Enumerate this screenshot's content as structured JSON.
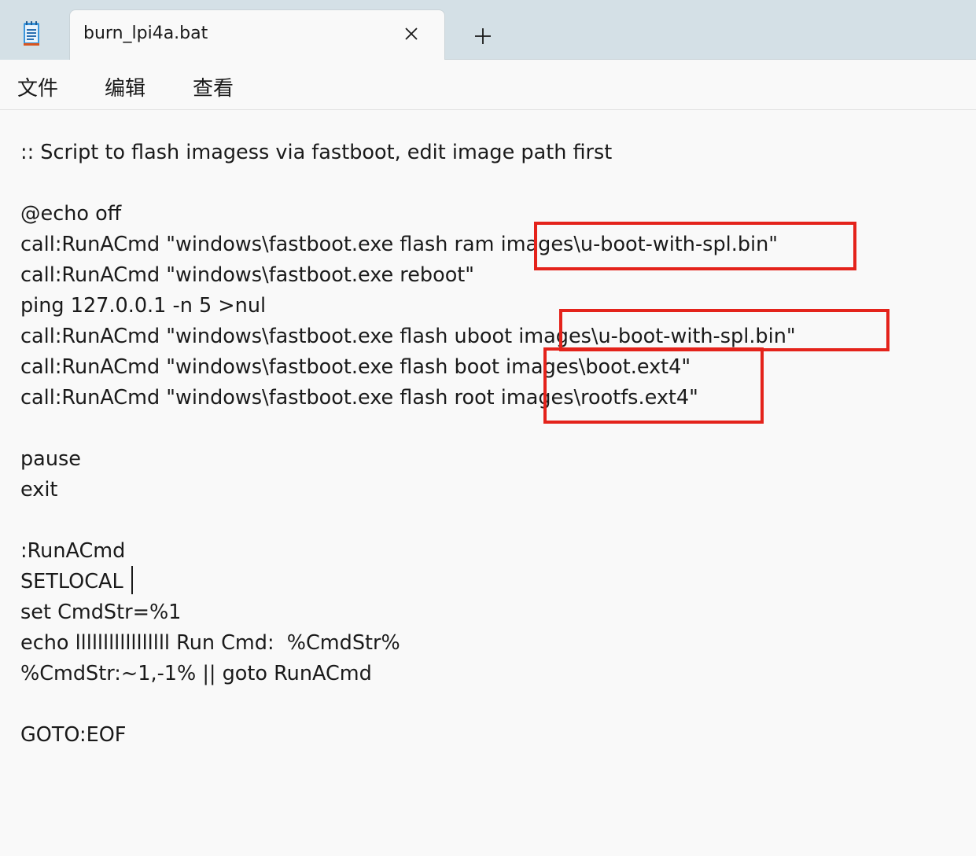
{
  "tab": {
    "title": "burn_lpi4a.bat",
    "close_glyph": "✕",
    "new_tab_glyph": "+"
  },
  "menu": {
    "items": [
      "文件",
      "编辑",
      "查看"
    ]
  },
  "editor": {
    "lines": [
      ":: Script to flash imagess via fastboot, edit image path first",
      "",
      "@echo off",
      "call:RunACmd \"windows\\fastboot.exe flash ram images\\u-boot-with-spl.bin\"",
      "call:RunACmd \"windows\\fastboot.exe reboot\"",
      "ping 127.0.0.1 -n 5 >nul",
      "call:RunACmd \"windows\\fastboot.exe flash uboot images\\u-boot-with-spl.bin\"",
      "call:RunACmd \"windows\\fastboot.exe flash boot images\\boot.ext4\"",
      "call:RunACmd \"windows\\fastboot.exe flash root images\\rootfs.ext4\"",
      "",
      "pause",
      "exit",
      "",
      ":RunACmd",
      "SETLOCAL",
      "set CmdStr=%1",
      "echo lllllllllllllllll Run Cmd:  %CmdStr%",
      "%CmdStr:~1,-1% || goto RunACmd",
      "",
      "GOTO:EOF"
    ]
  },
  "icons": {
    "app": "notepad-icon",
    "close": "close-icon",
    "new_tab": "plus-icon"
  },
  "colors": {
    "highlight": "#e4231b",
    "tabbar": "#d4e0e6",
    "background": "#f9f9f9"
  }
}
